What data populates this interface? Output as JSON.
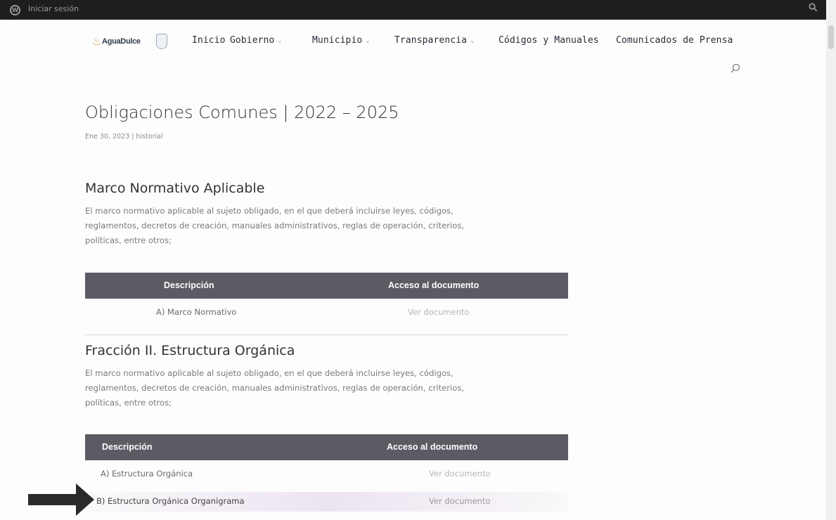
{
  "adminbar": {
    "login_label": "Iniciar sesión"
  },
  "nav": {
    "logo_text": "AguaDulce",
    "items": [
      {
        "label": "Inicio",
        "has_dropdown": false
      },
      {
        "label": "Gobierno",
        "has_dropdown": true
      },
      {
        "label": "Municipio",
        "has_dropdown": true
      },
      {
        "label": "Transparencia",
        "has_dropdown": true
      },
      {
        "label": "Códigos y Manuales",
        "has_dropdown": false
      },
      {
        "label": "Comunicados de Prensa",
        "has_dropdown": false
      }
    ],
    "search_icon": "search-icon",
    "chevron": "⌄"
  },
  "page": {
    "title": "Obligaciones Comunes | 2022 – 2025",
    "meta": "Ene 30, 2023 | historial"
  },
  "sections": [
    {
      "title": "Marco Normativo Aplicable",
      "paragraph_lines": [
        "El marco normativo aplicable al sujeto obligado, en el que deberá incluirse leyes, códigos,",
        "reglamentos, decretos de creación, manuales administrativos, reglas de operación, criterios,",
        "políticas, entre otros;"
      ],
      "table": {
        "headers": [
          "Descripción",
          "Acceso al documento"
        ],
        "rows": [
          {
            "desc": "A) Marco Normativo",
            "link": "Ver documento"
          }
        ]
      }
    },
    {
      "title": "Fracción II. Estructura Orgánica",
      "paragraph_lines": [
        "El marco normativo aplicable al sujeto obligado, en el que deberá incluirse leyes, códigos,",
        "reglamentos, decretos de creación, manuales administrativos, reglas de operación, criterios,",
        "políticas, entre otros;"
      ],
      "table": {
        "headers": [
          "Descripción",
          "Acceso al documento"
        ],
        "rows": [
          {
            "desc": "A) Estructura Orgánica",
            "link": "Ver documento"
          },
          {
            "desc": "B) Estructura Orgánica Organigrama",
            "link": "Ver documento"
          }
        ]
      }
    }
  ],
  "colors": {
    "table_header_bg": "#5b5b63",
    "admin_bar_bg": "#1e1e1e",
    "link": "#b5b5b5"
  }
}
